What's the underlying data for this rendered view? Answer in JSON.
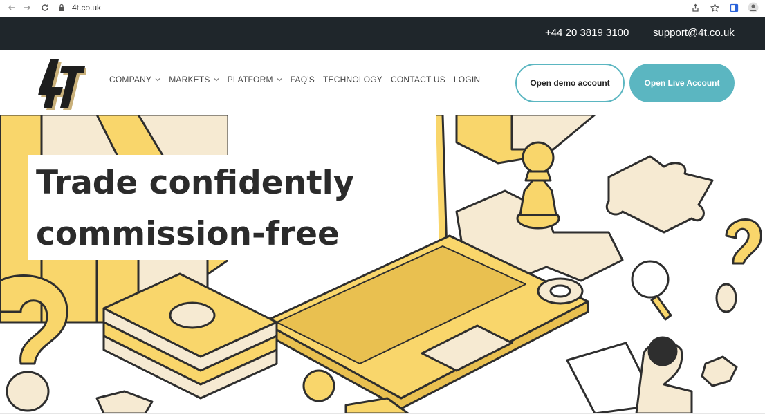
{
  "browser": {
    "url": "4t.co.uk",
    "icons": [
      "back-arrow-icon",
      "forward-arrow-icon",
      "reload-icon",
      "lock-icon",
      "share-icon",
      "star-icon",
      "reader-mode-icon",
      "profile-icon"
    ]
  },
  "topbar": {
    "phone": "+44 20 3819 3100",
    "email": "support@4t.co.uk"
  },
  "header": {
    "logo_text": "4T",
    "menu": [
      {
        "label": "COMPANY",
        "has_dropdown": true
      },
      {
        "label": "MARKETS",
        "has_dropdown": true
      },
      {
        "label": "PLATFORM",
        "has_dropdown": true
      },
      {
        "label": "FAQ'S",
        "has_dropdown": false
      },
      {
        "label": "TECHNOLOGY",
        "has_dropdown": false
      },
      {
        "label": "CONTACT US",
        "has_dropdown": false
      },
      {
        "label": "LOGIN",
        "has_dropdown": false
      }
    ],
    "demo_button": "Open demo account",
    "live_button": "Open Live Account"
  },
  "hero": {
    "line1": "Trade confidently",
    "line2": "commission-free"
  },
  "colors": {
    "topbar_bg": "#1f262b",
    "accent": "#5bb6c1",
    "illustration_yellow": "#f9d66b",
    "illustration_cream": "#f6ead2",
    "outline": "#2e2e2e"
  }
}
